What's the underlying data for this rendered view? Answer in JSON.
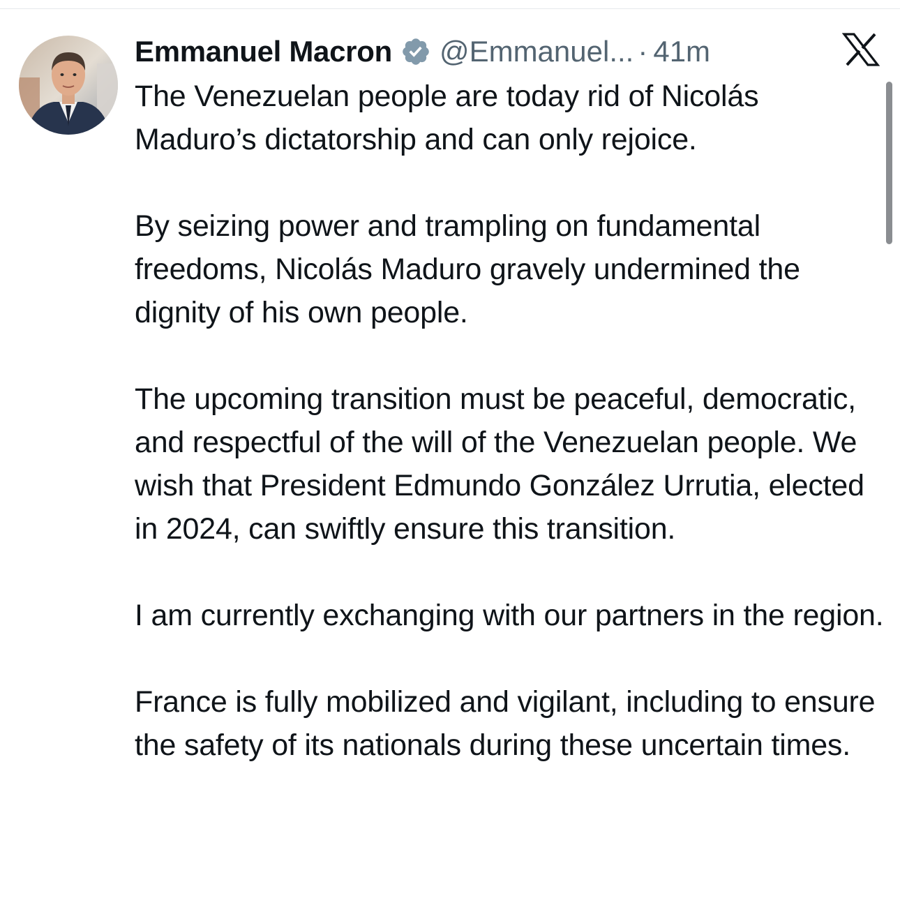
{
  "tweet": {
    "author": {
      "display_name": "Emmanuel Macron",
      "handle": "@Emmanuel...",
      "verified": true,
      "verified_badge_color": "#829aab"
    },
    "separator": "·",
    "timestamp": "41m",
    "platform_icon": "x-logo-icon",
    "paragraphs": [
      "The Venezuelan people are today rid of Nicolás Maduro’s dictatorship and can only rejoice.",
      "By seizing power and trampling on fundamental freedoms, Nicolás Maduro gravely undermined the dignity of his own people.",
      "The upcoming transition must be peaceful, democratic, and respectful of the will of the Venezuelan people. We wish that President Edmundo González Urrutia, elected in 2024, can swiftly ensure this transition.",
      "I am currently exchanging with our partners in the region.",
      "France is fully mobilized and vigilant, including to ensure the safety of its nationals during these uncertain times."
    ]
  },
  "colors": {
    "text_primary": "#0f1419",
    "text_secondary": "#536471",
    "background": "#ffffff"
  }
}
